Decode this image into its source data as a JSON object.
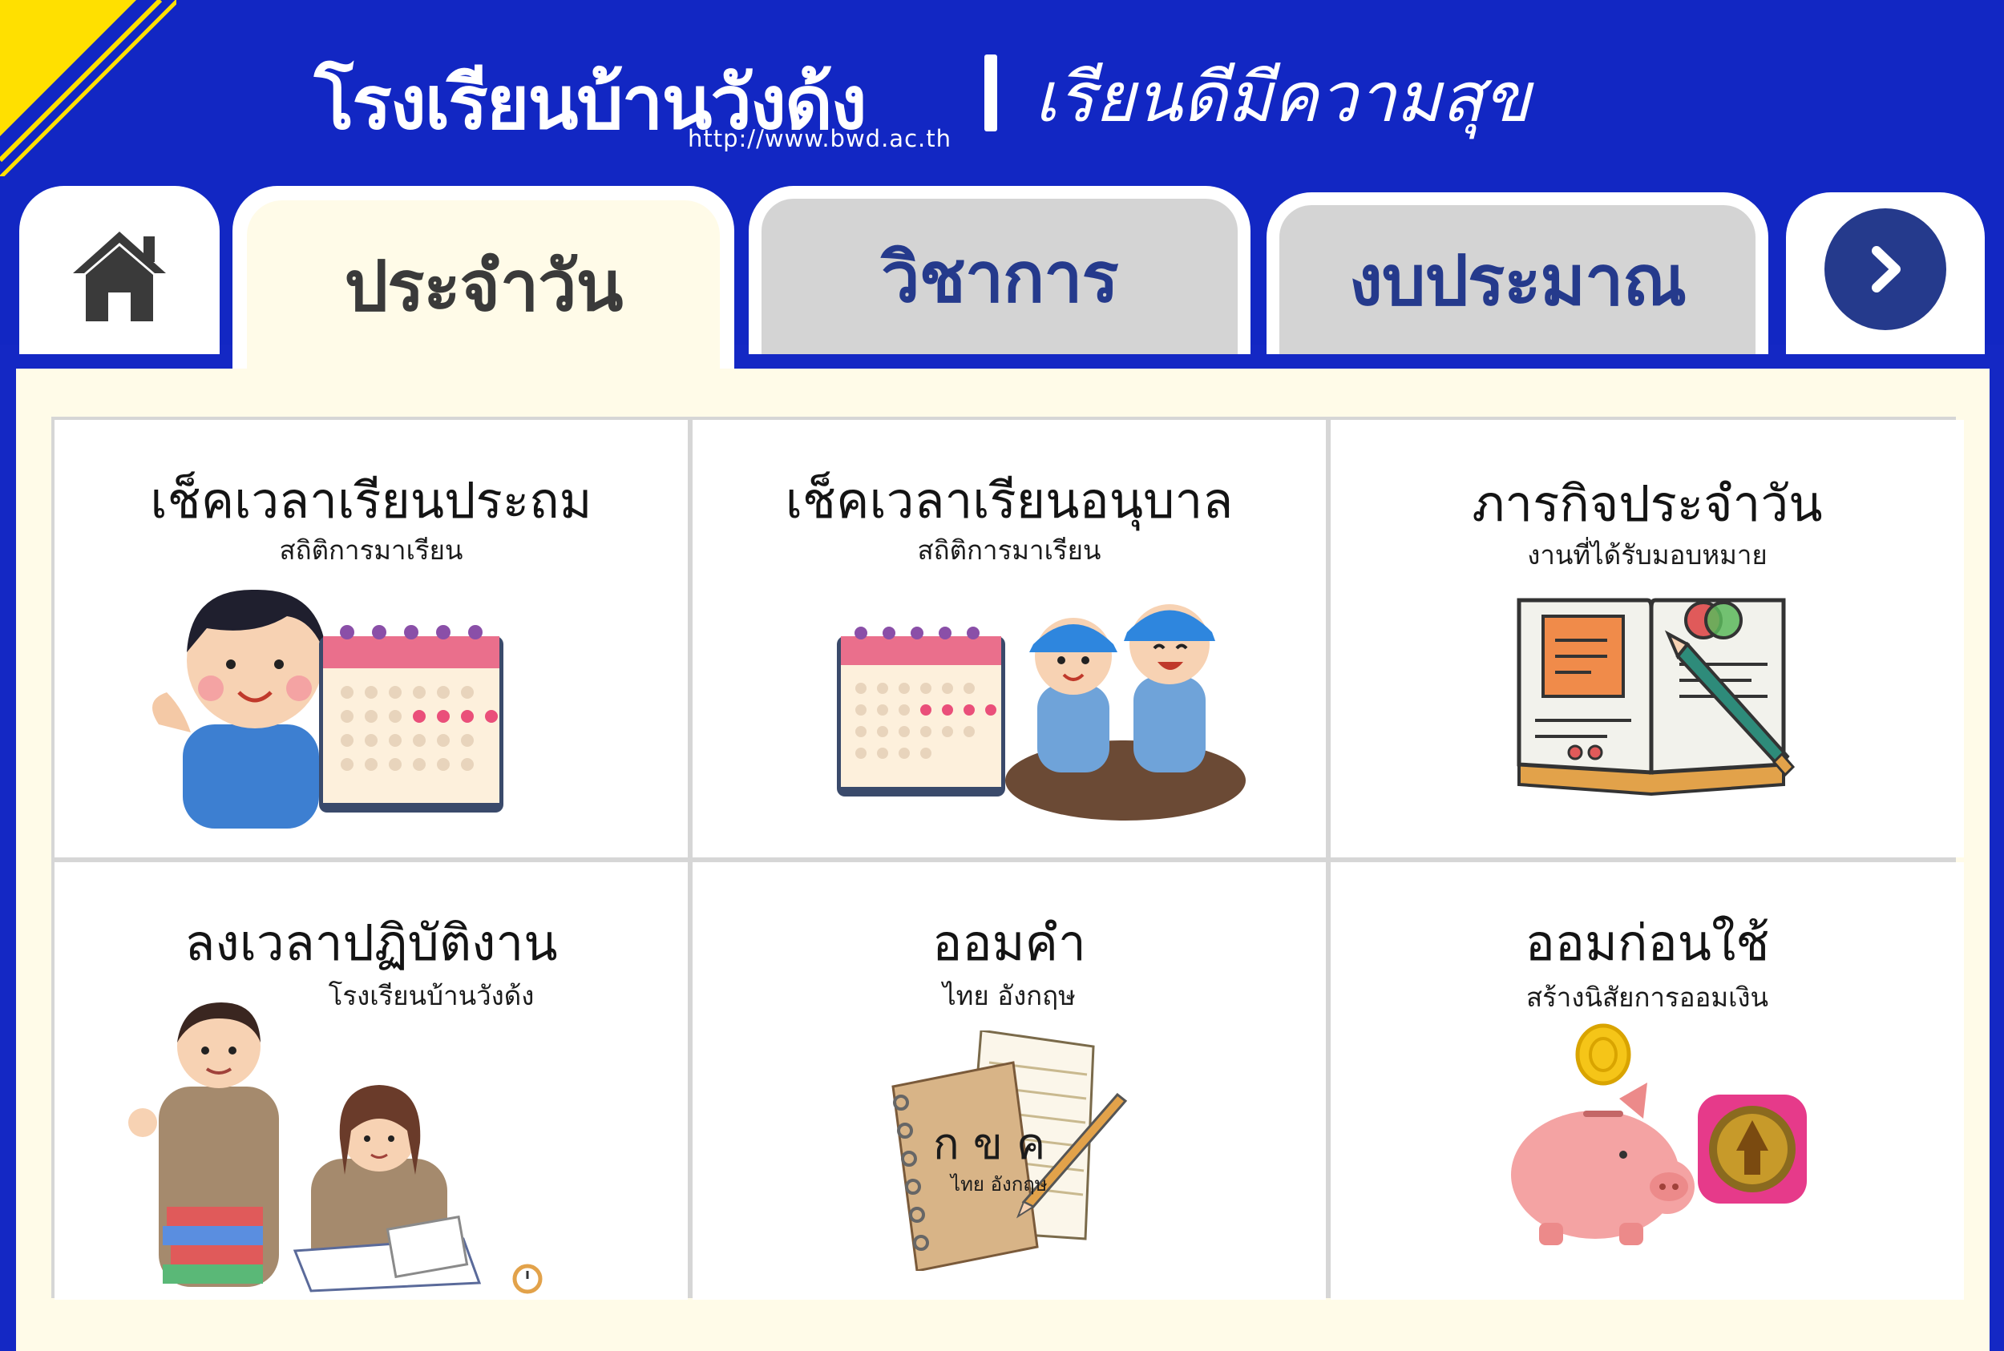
{
  "header": {
    "title": "โรงเรียนบ้านวังด้ง",
    "slogan": "เรียนดีมีความสุข",
    "url": "http://www.bwd.ac.th"
  },
  "tabs": [
    {
      "label": "",
      "icon": "home-icon",
      "active": false
    },
    {
      "label": "ประจำวัน",
      "active": true
    },
    {
      "label": "วิชาการ",
      "active": false
    },
    {
      "label": "งบประมาณ",
      "active": false
    },
    {
      "label": "",
      "icon": "chevron-right-icon",
      "active": false
    }
  ],
  "cards": [
    {
      "title": "เช็คเวลาเรียนประถม",
      "subtitle": "สถิติการมาเรียน",
      "icon": "boy-calendar-illustration"
    },
    {
      "title": "เช็คเวลาเรียนอนุบาล",
      "subtitle": "สถิติการมาเรียน",
      "icon": "kids-calendar-illustration"
    },
    {
      "title": "ภารกิจประจำวัน",
      "subtitle": "งานที่ได้รับมอบหมาย",
      "icon": "open-book-illustration"
    },
    {
      "title": "ลงเวลาปฏิบัติงาน",
      "subtitle": "โรงเรียนบ้านวังด้ง",
      "icon": "teachers-illustration"
    },
    {
      "title": "ออมคำ",
      "subtitle": "ไทย  อังกฤษ",
      "icon": "notebook-illustration"
    },
    {
      "title": "ออมก่อนใช้",
      "subtitle": "สร้างนิสัยการออมเงิน",
      "icon": "piggy-bank-illustration"
    }
  ],
  "notebook": {
    "letters": "ก  ข  ค",
    "caption": "ไทย อังกฤษ"
  },
  "colors": {
    "header_blue": "#1227c3",
    "accent_yellow": "#ffe000",
    "tab_blue": "#253a8c",
    "panel_cream": "#fffbe8",
    "tab_gray": "#d4d4d4"
  }
}
